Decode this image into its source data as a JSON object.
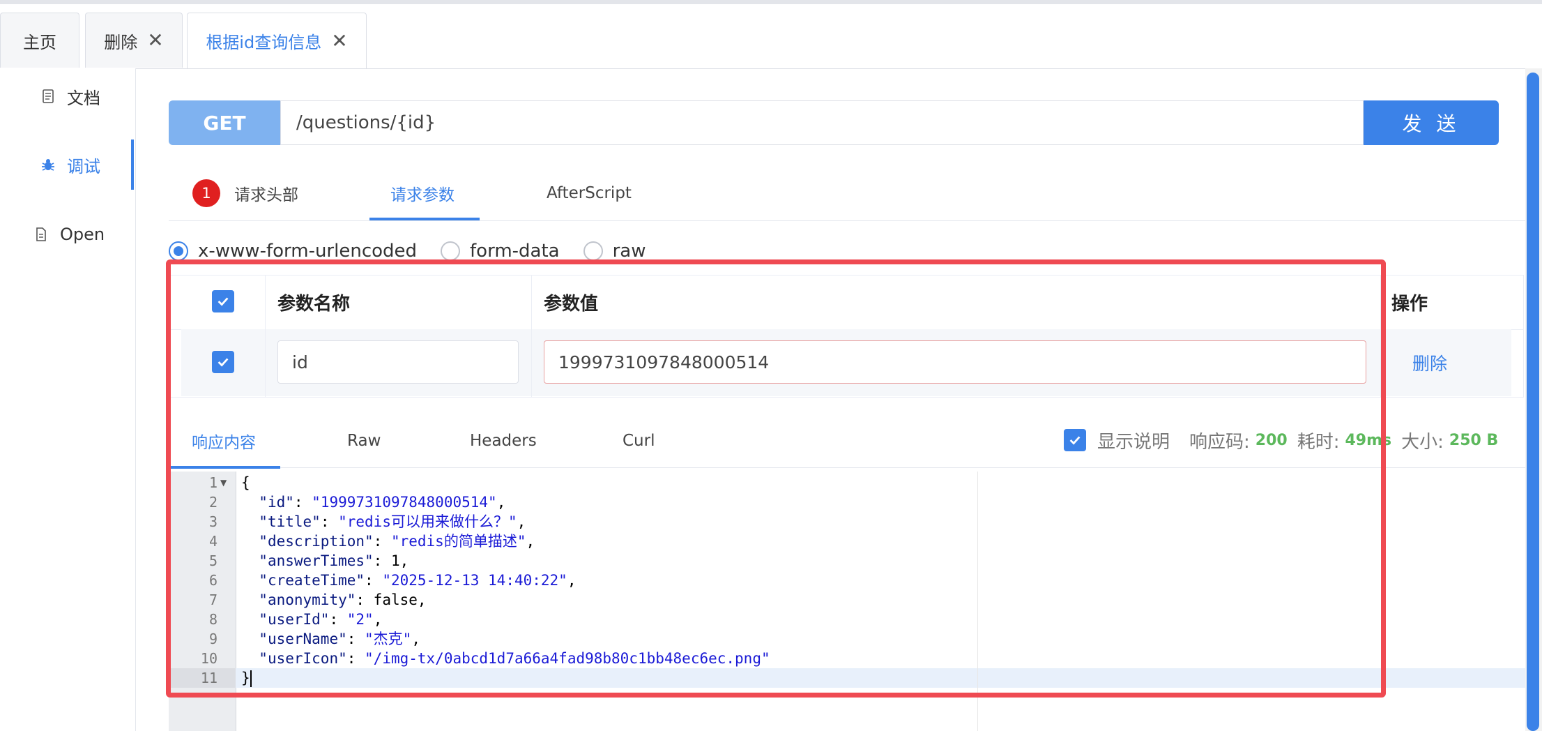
{
  "tabs": [
    {
      "label": "主页",
      "closable": false,
      "active": false
    },
    {
      "label": "删除",
      "closable": true,
      "active": false
    },
    {
      "label": "根据id查询信息",
      "closable": true,
      "active": true
    }
  ],
  "sidebar": {
    "items": [
      {
        "label": "文档",
        "icon": "document-icon",
        "active": false
      },
      {
        "label": "调试",
        "icon": "bug-icon",
        "active": true
      },
      {
        "label": "Open",
        "icon": "file-icon",
        "active": false
      }
    ]
  },
  "request": {
    "method": "GET",
    "url": "/questions/{id}",
    "send_label": "发 送"
  },
  "request_tabs": {
    "headers_badge": "1",
    "headers": "请求头部",
    "params": "请求参数",
    "afterscript": "AfterScript"
  },
  "body_types": {
    "urlencoded": "x-www-form-urlencoded",
    "formdata": "form-data",
    "raw": "raw"
  },
  "params_table": {
    "col_name": "参数名称",
    "col_value": "参数值",
    "col_action": "操作",
    "rows": [
      {
        "checked": true,
        "name": "id",
        "value": "1999731097848000514",
        "action": "删除"
      }
    ]
  },
  "response": {
    "tabs": {
      "content": "响应内容",
      "raw": "Raw",
      "headers": "Headers",
      "curl": "Curl"
    },
    "show_desc": "显示说明",
    "code_label": "响应码:",
    "code": "200",
    "time_label": "耗时:",
    "time": "49ms",
    "size_label": "大小:",
    "size": "250 B",
    "line_numbers": [
      "1",
      "2",
      "3",
      "4",
      "5",
      "6",
      "7",
      "8",
      "9",
      "10",
      "11"
    ],
    "lines": {
      "l1": "{",
      "id_k": "\"id\"",
      "id_v": "\"1999731097848000514\"",
      "title_k": "\"title\"",
      "title_v": "\"redis可以用来做什么？\"",
      "desc_k": "\"description\"",
      "desc_v": "\"redis的简单描述\"",
      "at_k": "\"answerTimes\"",
      "at_v": "1",
      "ct_k": "\"createTime\"",
      "ct_v": "\"2025-12-13 14:40:22\"",
      "an_k": "\"anonymity\"",
      "an_v": "false",
      "uid_k": "\"userId\"",
      "uid_v": "\"2\"",
      "un_k": "\"userName\"",
      "un_v": "\"杰克\"",
      "ui_k": "\"userIcon\"",
      "ui_v": "\"/img-tx/0abcd1d7a66a4fad98b80c1bb48ec6ec.png\"",
      "l11": "}"
    }
  },
  "colors": {
    "accent": "#3b82e8",
    "highlight_border": "#ef4a52",
    "success": "#5cb85c",
    "badge": "#e02020"
  }
}
